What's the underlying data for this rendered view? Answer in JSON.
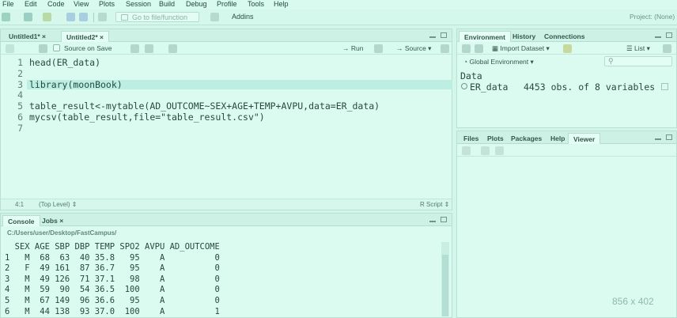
{
  "menu": [
    "File",
    "Edit",
    "Code",
    "View",
    "Plots",
    "Session",
    "Build",
    "Debug",
    "Profile",
    "Tools",
    "Help"
  ],
  "toolbar": {
    "goto_placeholder": "Go to file/function",
    "addins_label": "Addins",
    "project_label": "Project: (None)"
  },
  "editor": {
    "tabs": [
      "Untitled1*",
      "Untitled2*"
    ],
    "source_on_save": "Source on Save",
    "run_label": "Run",
    "source_label": "Source",
    "lines": [
      {
        "n": "1",
        "code": "head(ER_data)"
      },
      {
        "n": "2",
        "code": ""
      },
      {
        "n": "3",
        "code": "library(moonBook)"
      },
      {
        "n": "4",
        "code": ""
      },
      {
        "n": "5",
        "code": "table_result<-mytable(AD_OUTCOME~SEX+AGE+TEMP+AVPU,data=ER_data)"
      },
      {
        "n": "6",
        "code": "mycsv(table_result,file=\"table_result.csv\")"
      },
      {
        "n": "7",
        "code": ""
      }
    ],
    "status_pos": "4:1",
    "status_scope": "(Top Level)",
    "status_type": "R Script"
  },
  "console": {
    "tabs": [
      "Console",
      "Jobs"
    ],
    "path": "C:/Users/user/Desktop/FastCampus/",
    "output": [
      "  SEX AGE SBP DBP TEMP SPO2 AVPU AD_OUTCOME",
      "1   M  68  63  40 35.8   95    A          0",
      "2   F  49 161  87 36.7   95    A          0",
      "3   M  49 126  71 37.1   98    A          0",
      "4   M  59  90  54 36.5  100    A          0",
      "5   M  67 149  96 36.6   95    A          0",
      "6   M  44 138  93 37.0  100    A          1"
    ]
  },
  "environment": {
    "tabs": [
      "Environment",
      "History",
      "Connections"
    ],
    "import_label": "Import Dataset",
    "list_label": "List",
    "scope_label": "Global Environment",
    "section_label": "Data",
    "items": [
      {
        "name": "ER_data",
        "desc": "4453 obs. of 8 variables"
      }
    ]
  },
  "files": {
    "tabs": [
      "Files",
      "Plots",
      "Packages",
      "Help",
      "Viewer"
    ]
  },
  "watermark": "856 x 402",
  "colors": {
    "background": "#d2f7ea",
    "highlight": "#bceee2"
  }
}
